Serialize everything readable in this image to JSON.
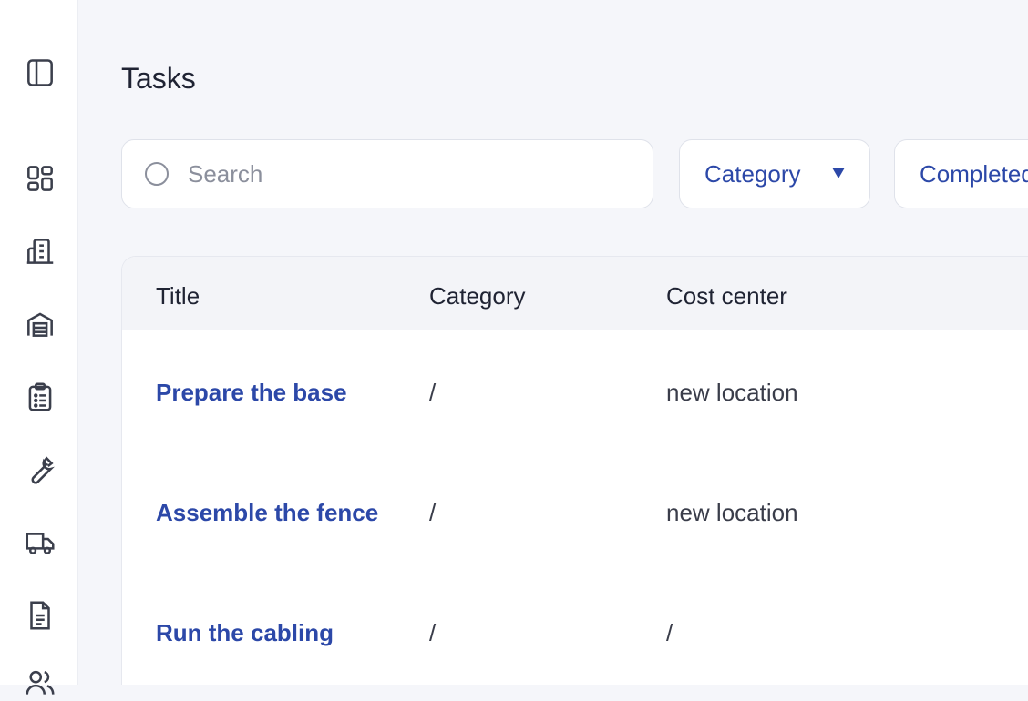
{
  "page": {
    "title": "Tasks"
  },
  "sidebar": {
    "items": [
      {
        "icon": "sidebar-toggle-icon"
      },
      {
        "icon": "dashboard-icon"
      },
      {
        "icon": "buildings-icon"
      },
      {
        "icon": "warehouse-icon"
      },
      {
        "icon": "clipboard-list-icon"
      },
      {
        "icon": "wrench-icon"
      },
      {
        "icon": "truck-icon"
      },
      {
        "icon": "document-icon"
      },
      {
        "icon": "users-icon"
      }
    ]
  },
  "search": {
    "placeholder": "Search",
    "value": ""
  },
  "filters": {
    "category_label": "Category",
    "completed_label": "Completed"
  },
  "table": {
    "columns": [
      "Title",
      "Category",
      "Cost center"
    ],
    "rows": [
      {
        "title": "Prepare the base",
        "category": "/",
        "cost_center": "new location"
      },
      {
        "title": "Assemble the fence",
        "category": "/",
        "cost_center": "new location"
      },
      {
        "title": "Run the cabling",
        "category": "/",
        "cost_center": "/"
      }
    ]
  },
  "colors": {
    "accent": "#2c48a8",
    "background": "#f5f6fa",
    "text": "#1f2333",
    "muted": "#8b8f9c"
  }
}
